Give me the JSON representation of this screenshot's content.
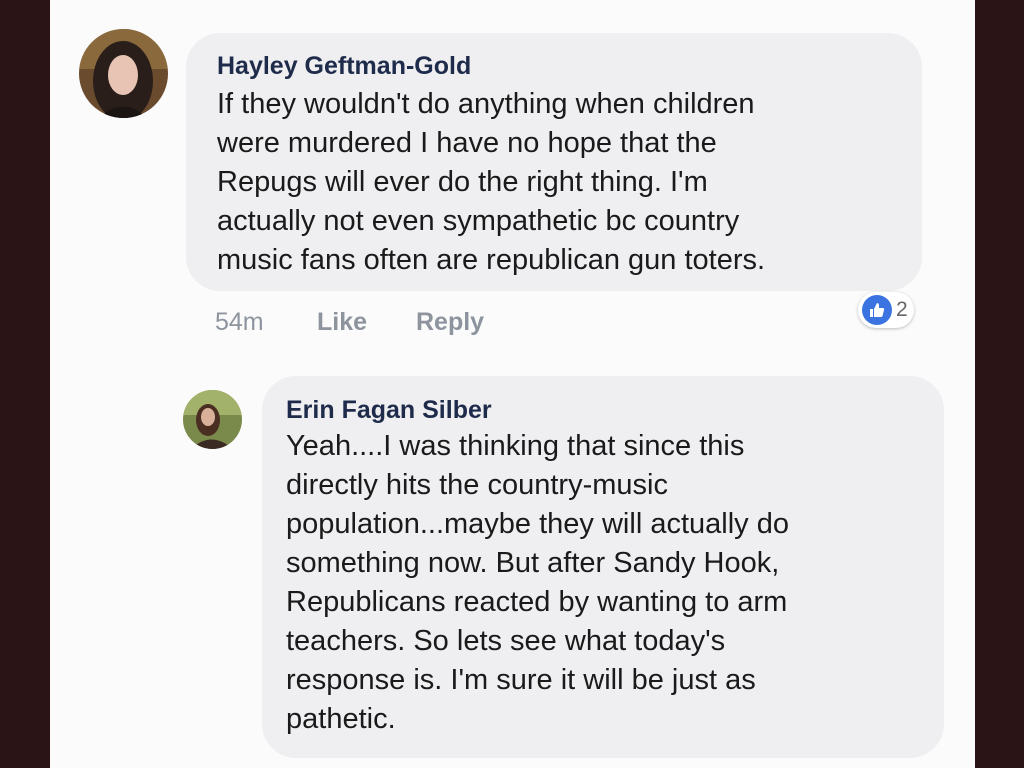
{
  "comments": [
    {
      "author": "Hayley Geftman-Gold",
      "text": "If they wouldn't do anything when children\nwere murdered I have no hope that the\nRepugs will ever do the right thing.  I'm\nactually not even sympathetic bc country\nmusic fans often are republican gun toters.",
      "time": "54m",
      "like_label": "Like",
      "reply_label": "Reply",
      "reaction_count": "2",
      "reaction_icon": "thumbs-up-icon",
      "reaction_color": "#3b73e0"
    },
    {
      "author": "Erin Fagan Silber",
      "text": "Yeah....I was thinking that since this\ndirectly hits the country-music\npopulation...maybe they will actually do\nsomething now.  But after Sandy Hook,\nRepublicans reacted by wanting to arm\nteachers.  So lets see what today's\nresponse is.  I'm sure it will be just as\npathetic."
    }
  ],
  "colors": {
    "bubble": "#efeff1",
    "author": "#1e2b4a",
    "meta": "#8d949e",
    "border": "#2b1416"
  }
}
